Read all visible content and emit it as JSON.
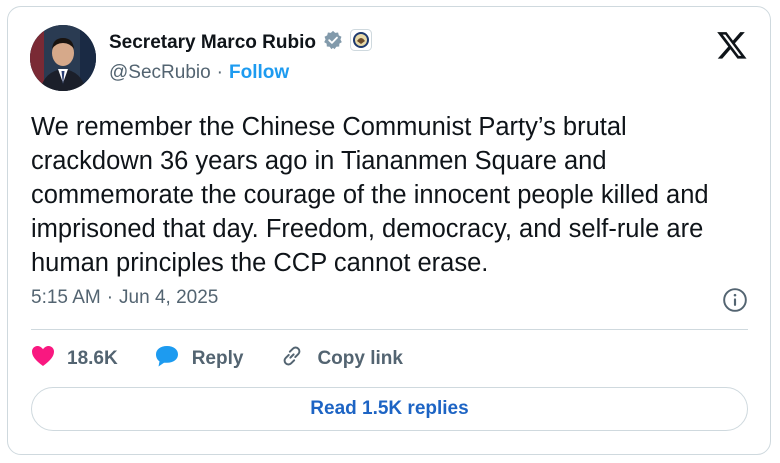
{
  "author": {
    "name": "Secretary Marco Rubio",
    "handle": "@SecRubio",
    "separator": "·",
    "follow_label": "Follow"
  },
  "tweet": {
    "text": "We remember the Chinese Communist Party’s brutal crackdown 36 years ago in Tiananmen Square and commemorate the courage of the innocent people killed and imprisoned that day. Freedom, democracy, and self-rule are human principles the CCP cannot erase.",
    "time": "5:15 AM",
    "separator": "·",
    "date": "Jun 4, 2025"
  },
  "actions": {
    "like_count": "18.6K",
    "reply_label": "Reply",
    "copy_label": "Copy link",
    "read_replies_label": "Read 1.5K replies"
  },
  "icons": {
    "verified": "verified-badge-icon",
    "affiliate": "state-department-seal-icon",
    "platform": "x-logo-icon",
    "info": "info-icon",
    "like": "heart-icon",
    "reply": "speech-bubble-icon",
    "copy": "link-icon"
  },
  "colors": {
    "accent": "#1d9bf0",
    "like": "#f91880",
    "reply_bubble": "#1d9bf0",
    "text": "#0f1419",
    "muted": "#536471",
    "border": "#cfd9de"
  }
}
